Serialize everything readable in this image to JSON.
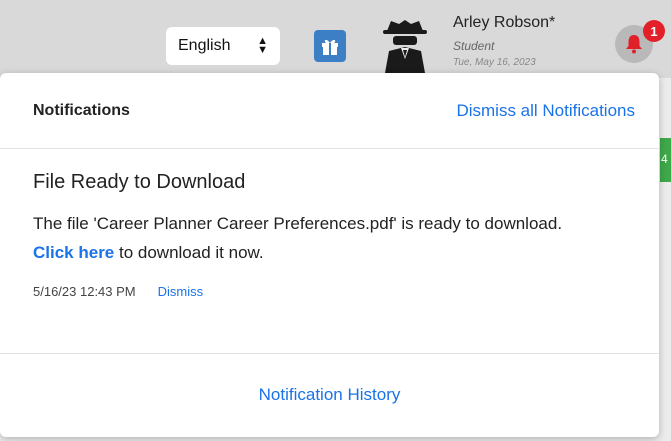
{
  "header": {
    "language": {
      "selected": "English"
    },
    "gift_icon": "gift-icon",
    "user": {
      "name": "Arley Robson*",
      "role": "Student",
      "date": "Tue, May 16, 2023"
    },
    "bell_icon": "bell-icon",
    "notification_count": "1",
    "side_badge": "4"
  },
  "notifications": {
    "title": "Notifications",
    "dismiss_all_label": "Dismiss all Notifications",
    "items": [
      {
        "title": "File Ready to Download",
        "message": "The file 'Career Planner Career Preferences.pdf' is ready to download.",
        "link_label": "Click here",
        "link_suffix": " to download it now.",
        "timestamp": "5/16/23 12:43 PM",
        "dismiss_label": "Dismiss"
      }
    ],
    "history_label": "Notification History"
  },
  "colors": {
    "link": "#1a73e8",
    "badge": "#e2202a",
    "gift_button": "#3d7fc4",
    "accent_green": "#3fa84a"
  }
}
